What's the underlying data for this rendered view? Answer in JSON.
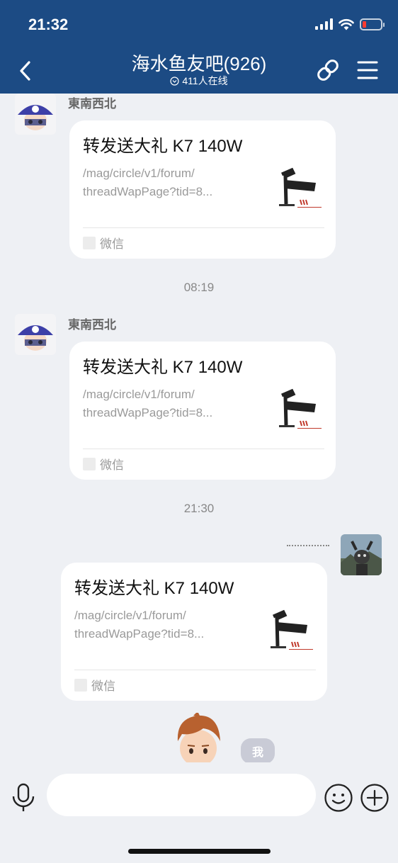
{
  "status_bar": {
    "time": "21:32"
  },
  "header": {
    "title": "海水鱼友吧(926)",
    "online_count": "411人在线",
    "icons": [
      "chevron-left-icon",
      "link-icon",
      "menu-icon"
    ]
  },
  "messages": [
    {
      "sender": "東南西北",
      "card": {
        "title": "转发送大礼 K7 140W",
        "desc_line1": "/mag/circle/v1/forum/",
        "desc_line2": "threadWapPage?tid=8...",
        "source": "微信"
      }
    },
    {
      "timestamp": "08:19"
    },
    {
      "sender": "東南西北",
      "card": {
        "title": "转发送大礼 K7 140W",
        "desc_line1": "/mag/circle/v1/forum/",
        "desc_line2": "threadWapPage?tid=8...",
        "source": "微信"
      }
    },
    {
      "timestamp": "21:30"
    },
    {
      "sender": "",
      "card": {
        "title": "转发送大礼 K7 140W",
        "desc_line1": "/mag/circle/v1/forum/",
        "desc_line2": "threadWapPage?tid=8...",
        "source": "微信"
      }
    }
  ],
  "me_badge": "我",
  "input": {
    "placeholder": ""
  },
  "colors": {
    "header_bg": "#1c4b84",
    "chat_bg": "#eef0f4",
    "battery_low": "#ff3b30"
  }
}
